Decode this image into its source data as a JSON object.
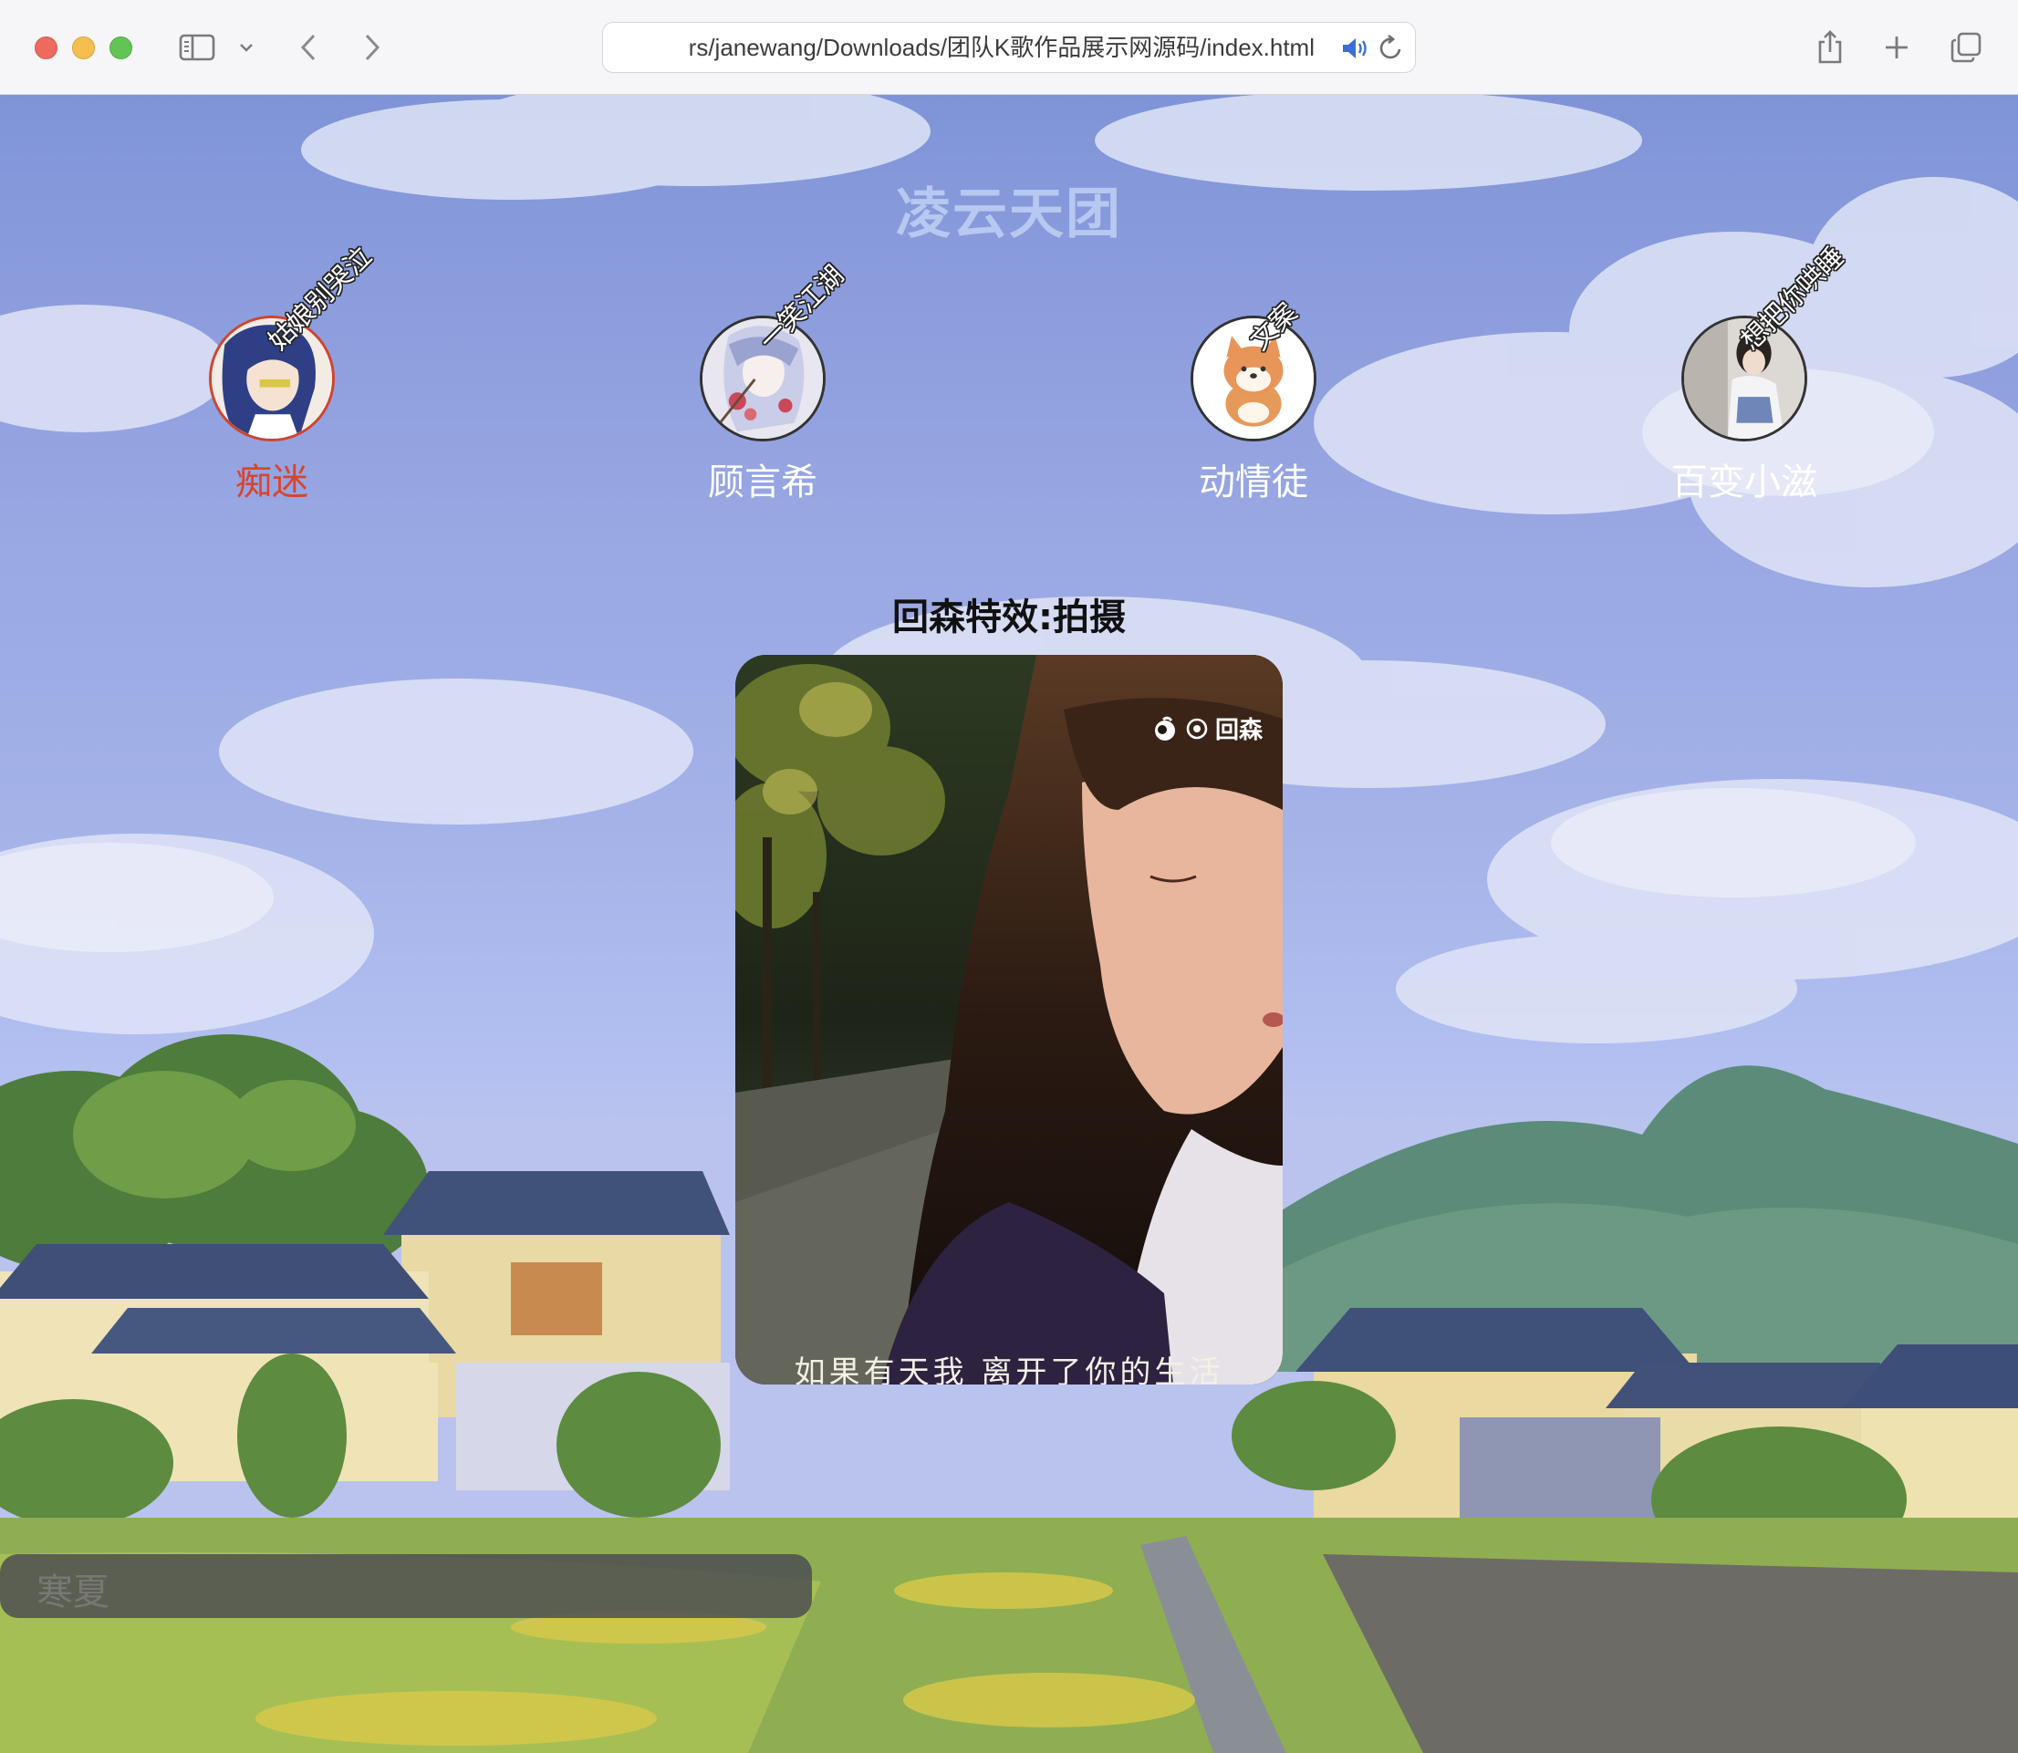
{
  "browser": {
    "url": "rs/janewang/Downloads/团队K歌作品展示网源码/index.html"
  },
  "page": {
    "title": "凌云天团",
    "effect_title": "回森特效:拍摄",
    "video": {
      "watermark": "回森",
      "subtitle": "如果有天我 离开了你的生活"
    },
    "members": [
      {
        "name": "痴迷",
        "tag": "姑娘别哭泣",
        "active": true
      },
      {
        "name": "顾言希",
        "tag": "一笑江湖",
        "active": false
      },
      {
        "name": "动情徒",
        "tag": "文案",
        "active": false
      },
      {
        "name": "百变小滋",
        "tag": "想把你哄睡",
        "active": false
      }
    ]
  },
  "colors": {
    "active_name": "#d8452f",
    "title": "#b7c8f1"
  }
}
